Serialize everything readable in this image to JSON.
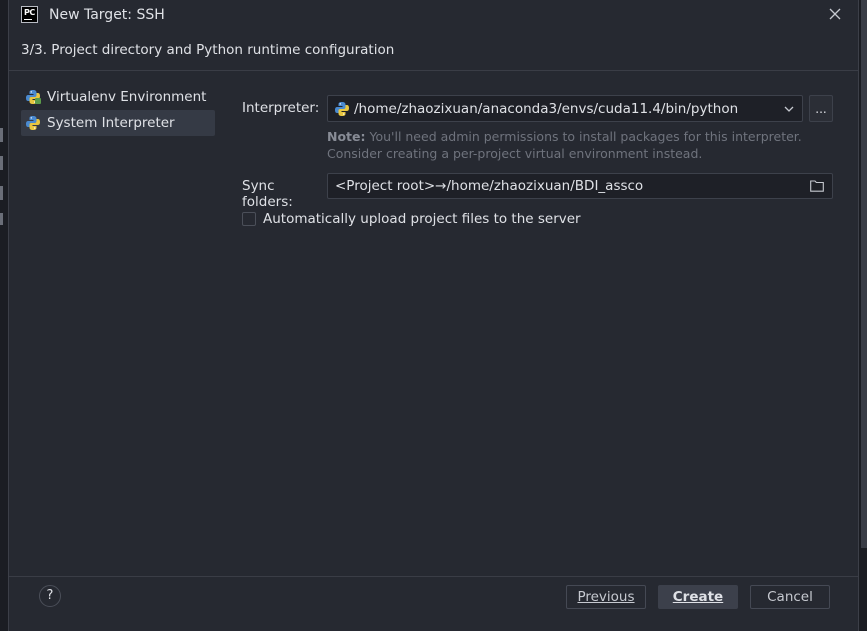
{
  "window": {
    "title": "New Target: SSH",
    "app_icon": "pycharm-logo",
    "app_icon_text": "PC"
  },
  "header": {
    "step": "3/3. Project directory and Python runtime configuration"
  },
  "sidebar": {
    "items": [
      {
        "label": "Virtualenv Environment",
        "icon": "python-virtualenv-icon",
        "selected": false
      },
      {
        "label": "System Interpreter",
        "icon": "python-icon",
        "selected": true
      }
    ]
  },
  "form": {
    "interpreter_label": "Interpreter:",
    "interpreter_value": "/home/zhaozixuan/anaconda3/envs/cuda11.4/bin/python",
    "browse_label": "...",
    "note_prefix": "Note:",
    "note_text": " You'll need admin permissions to install packages for this interpreter. Consider creating a per-project virtual environment instead.",
    "sync_label": "Sync folders:",
    "sync_value": "<Project root>→/home/zhaozixuan/BDI_assco",
    "auto_upload_label": "Automatically upload project files to the server",
    "auto_upload_checked": false
  },
  "footer": {
    "help_label": "?",
    "previous_label": "Previous",
    "create_label": "Create",
    "cancel_label": "Cancel"
  },
  "colors": {
    "background": "#262931",
    "primary_button": "#3c404b",
    "note_text": "#6f737d"
  }
}
